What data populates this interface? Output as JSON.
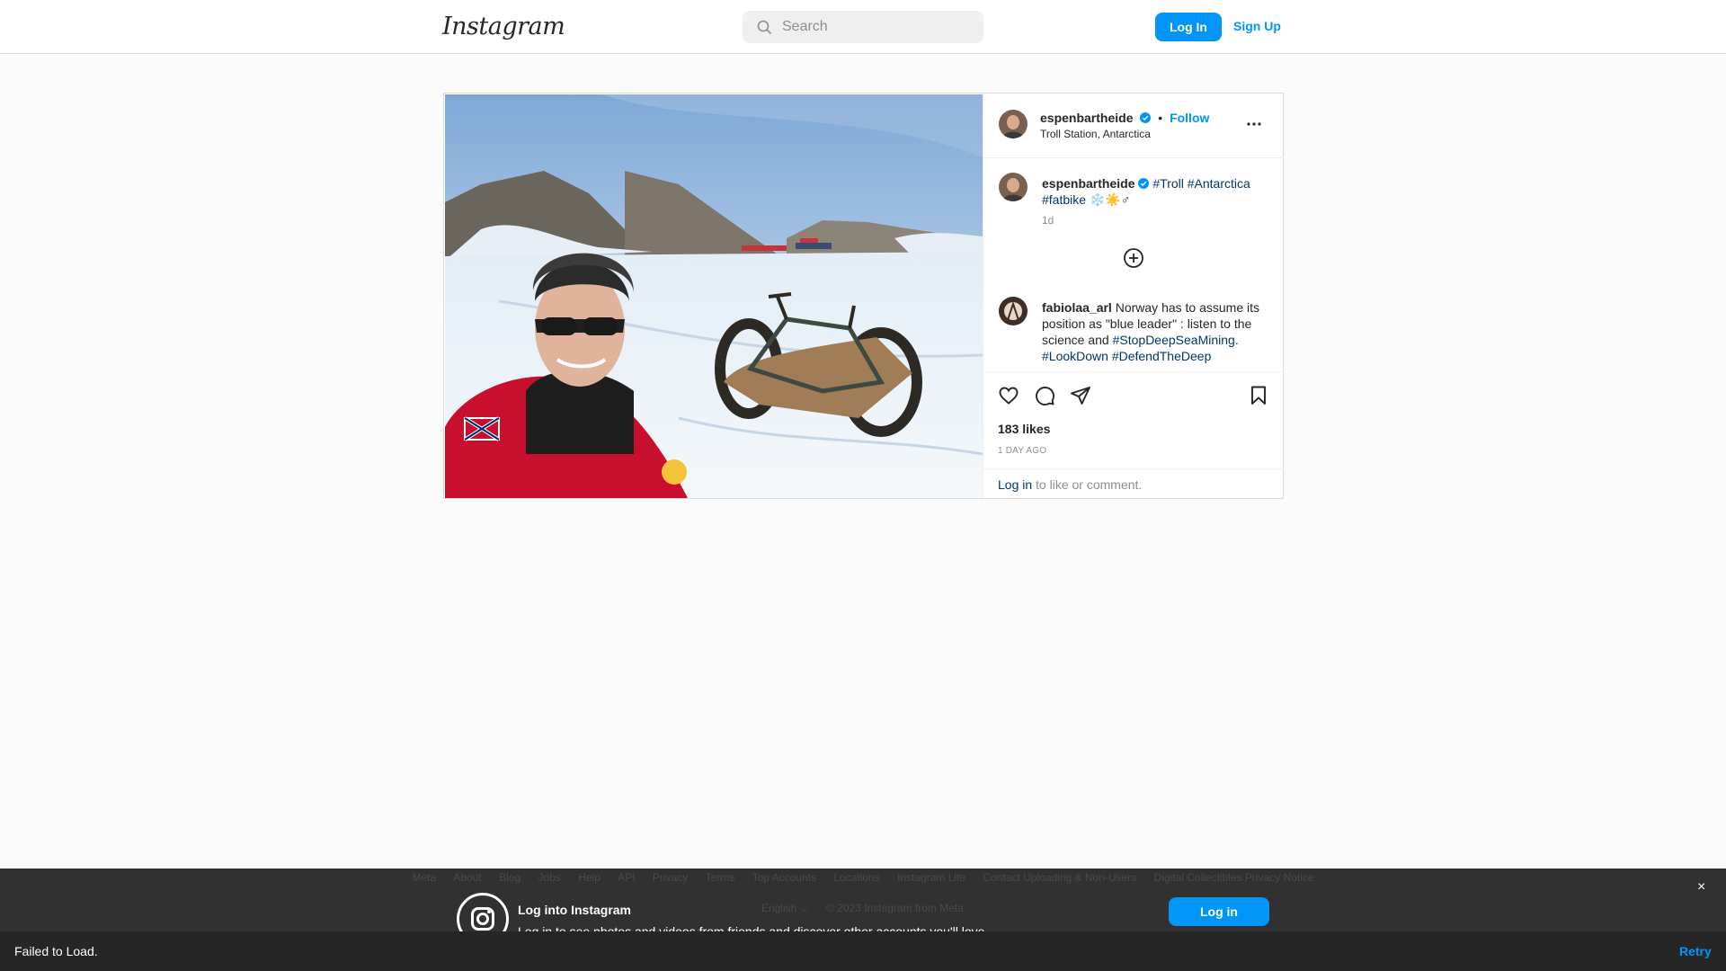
{
  "nav": {
    "logo_text": "Instagram",
    "search_placeholder": "Search",
    "login_label": "Log In",
    "signup_label": "Sign Up"
  },
  "post": {
    "author": "espenbartheide",
    "follow_label": "Follow",
    "separator": "•",
    "location": "Troll Station, Antarctica",
    "caption": {
      "username": "espenbartheide",
      "tags_line1": "#Troll #Antarctica",
      "tags_line2": "#fatbike",
      "emoji": "❄️☀️♂",
      "time": "1d"
    },
    "comment": {
      "username": "fabiolaa_arl",
      "text": "Norway has to assume its position as \"blue leader\" : listen to the science and",
      "tag1": "#StopDeepSeaMining.",
      "tag2": "#LookDown",
      "tag3": "#DefendTheDeep"
    },
    "likes": "183 likes",
    "time_ago": "1 DAY AGO",
    "login_link": "Log in",
    "login_suffix": " to like or comment."
  },
  "footer": {
    "links": [
      "Meta",
      "About",
      "Blog",
      "Jobs",
      "Help",
      "API",
      "Privacy",
      "Terms",
      "Top Accounts",
      "Locations",
      "Instagram Lite",
      "Contact Uploading & Non-Users",
      "Digital Collectibles Privacy Notice"
    ],
    "title": "Log into Instagram",
    "subtitle": "Log in to see photos and videos from friends and discover other accounts you'll love.",
    "language": "English ⌵",
    "copyright": "© 2023 Instagram from Meta",
    "login_label": "Log in",
    "close": "×"
  },
  "status_bar": {
    "message": "Failed to Load.",
    "retry_label": "Retry"
  },
  "colors": {
    "accent": "#0095f6",
    "tag": "#00376b",
    "muted": "#8e8e8e"
  },
  "icons": [
    "search-icon",
    "verified-badge-icon",
    "more-icon",
    "add-circle-icon",
    "heart-icon",
    "comment-icon",
    "share-icon",
    "bookmark-icon",
    "instagram-camera-icon"
  ]
}
